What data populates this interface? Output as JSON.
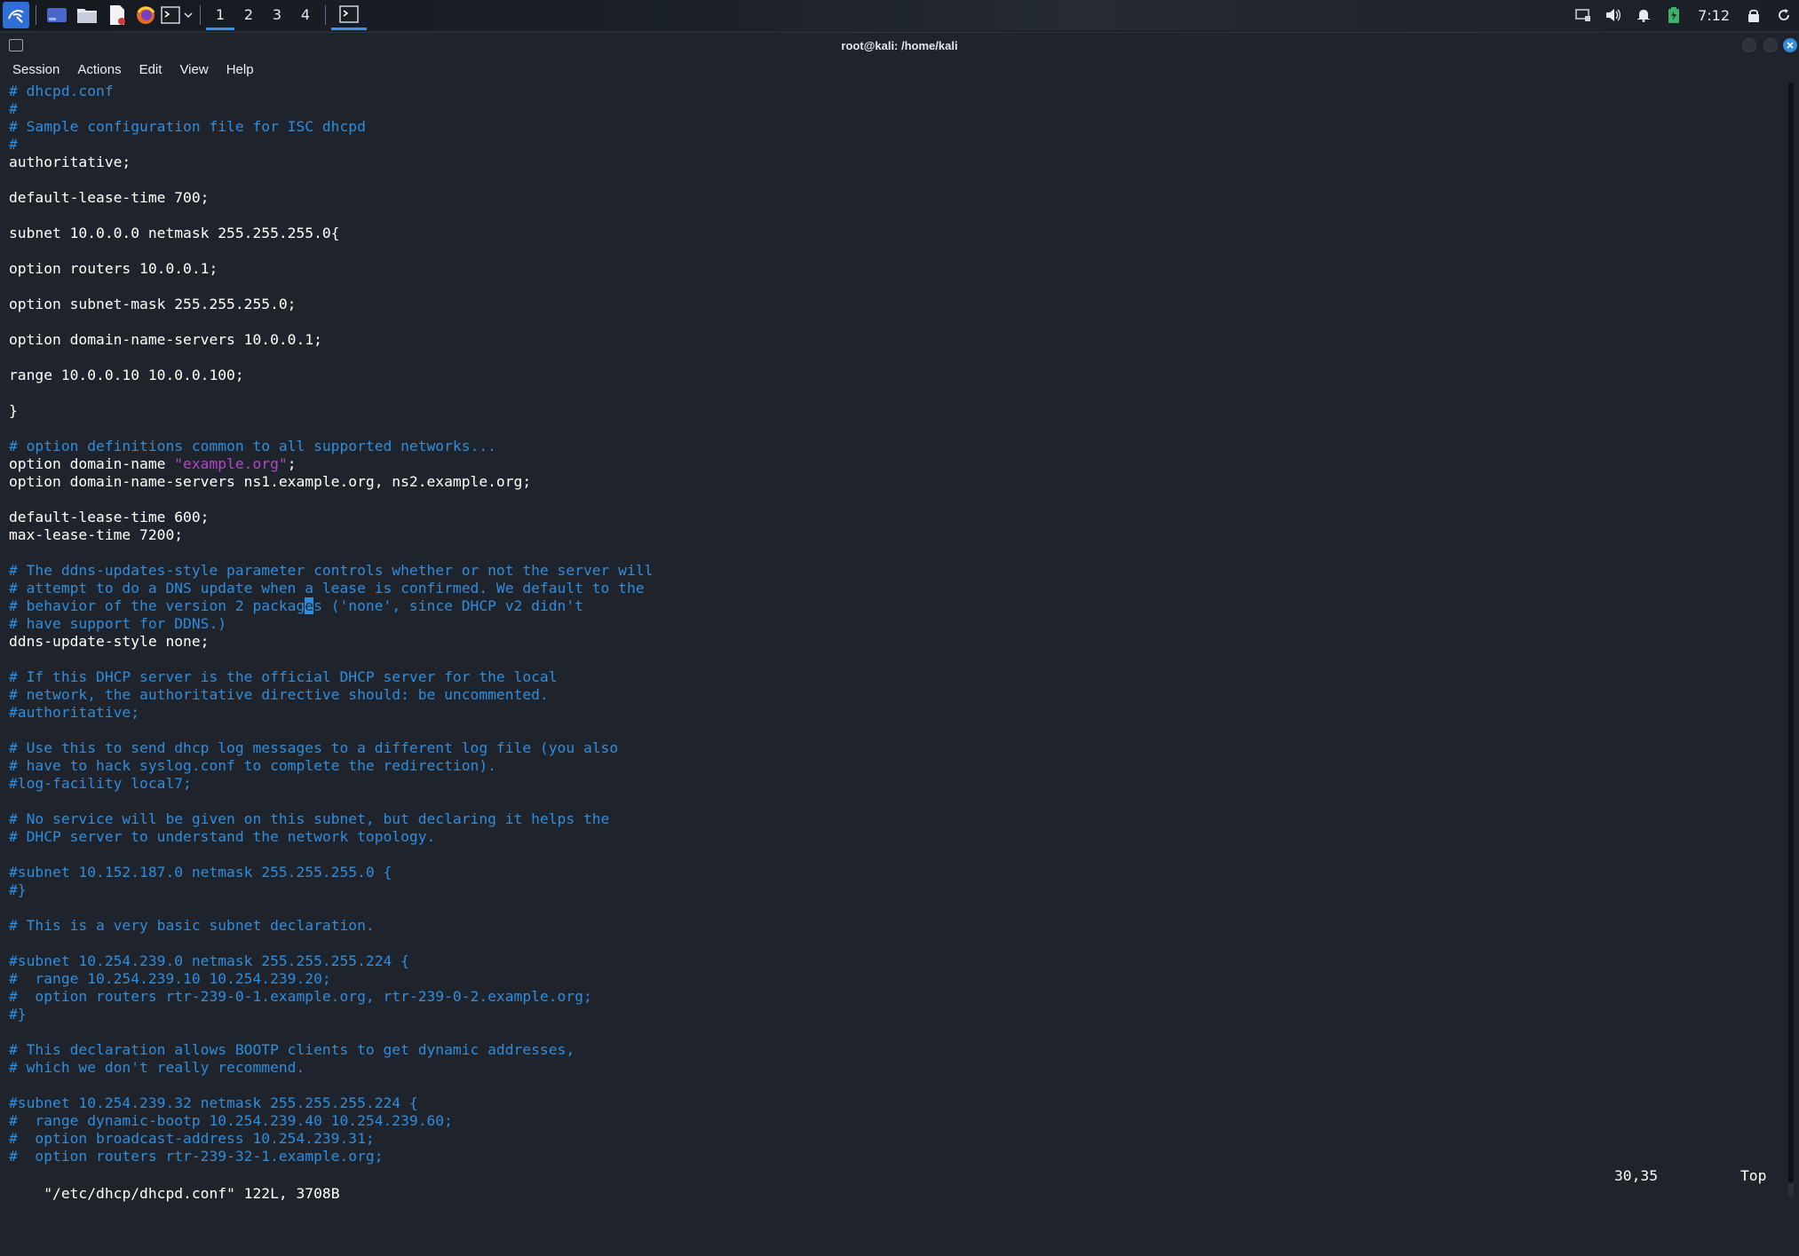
{
  "panel": {
    "workspaces": [
      "1",
      "2",
      "3",
      "4"
    ],
    "active_workspace": "1",
    "clock": "7:12",
    "icons": [
      "kali-menu-icon",
      "desktop-icon",
      "file-manager-icon",
      "text-editor-icon",
      "firefox-icon",
      "terminal-icon",
      "chevron-down-icon"
    ]
  },
  "window": {
    "title": "root@kali: /home/kali",
    "menu": [
      "Session",
      "Actions",
      "Edit",
      "View",
      "Help"
    ]
  },
  "editor": {
    "lines": [
      [
        {
          "t": "# dhcpd.conf",
          "k": "c"
        }
      ],
      [
        {
          "t": "#",
          "k": "c"
        }
      ],
      [
        {
          "t": "# Sample configuration file for ISC dhcpd",
          "k": "c"
        }
      ],
      [
        {
          "t": "#",
          "k": "c"
        }
      ],
      [
        {
          "t": "authoritative;",
          "k": "n"
        }
      ],
      [],
      [
        {
          "t": "default-lease-time 700;",
          "k": "n"
        }
      ],
      [],
      [
        {
          "t": "subnet 10.0.0.0 netmask 255.255.255.0{",
          "k": "n"
        }
      ],
      [],
      [
        {
          "t": "option routers 10.0.0.1;",
          "k": "n"
        }
      ],
      [],
      [
        {
          "t": "option subnet-mask 255.255.255.0;",
          "k": "n"
        }
      ],
      [],
      [
        {
          "t": "option domain-name-servers 10.0.0.1;",
          "k": "n"
        }
      ],
      [],
      [
        {
          "t": "range 10.0.0.10 10.0.0.100;",
          "k": "n"
        }
      ],
      [],
      [
        {
          "t": "}",
          "k": "n"
        }
      ],
      [],
      [
        {
          "t": "# option definitions common to all supported networks...",
          "k": "c"
        }
      ],
      [
        {
          "t": "option domain-name ",
          "k": "n"
        },
        {
          "t": "\"example.org\"",
          "k": "s"
        },
        {
          "t": ";",
          "k": "n"
        }
      ],
      [
        {
          "t": "option domain-name-servers ns1.example.org, ns2.example.org;",
          "k": "n"
        }
      ],
      [],
      [
        {
          "t": "default-lease-time 600;",
          "k": "n"
        }
      ],
      [
        {
          "t": "max-lease-time 7200;",
          "k": "n"
        }
      ],
      [],
      [
        {
          "t": "# The ddns-updates-style parameter controls whether or not the server will",
          "k": "c"
        }
      ],
      [
        {
          "t": "# attempt to do a DNS update when a lease is confirmed. We default to the",
          "k": "c"
        }
      ],
      [
        {
          "t": "# behavior of the version 2 packag",
          "k": "c"
        },
        {
          "t": "e",
          "k": "cursor"
        },
        {
          "t": "s ('none', since DHCP v2 didn't",
          "k": "c"
        }
      ],
      [
        {
          "t": "# have support for DDNS.)",
          "k": "c"
        }
      ],
      [
        {
          "t": "ddns-update-style none;",
          "k": "n"
        }
      ],
      [],
      [
        {
          "t": "# If this DHCP server is the official DHCP server for the local",
          "k": "c"
        }
      ],
      [
        {
          "t": "# network, the authoritative directive should: be uncommented.",
          "k": "c"
        }
      ],
      [
        {
          "t": "#authoritative;",
          "k": "c"
        }
      ],
      [],
      [
        {
          "t": "# Use this to send dhcp log messages to a different log file (you also",
          "k": "c"
        }
      ],
      [
        {
          "t": "# have to hack syslog.conf to complete the redirection).",
          "k": "c"
        }
      ],
      [
        {
          "t": "#log-facility local7;",
          "k": "c"
        }
      ],
      [],
      [
        {
          "t": "# No service will be given on this subnet, but declaring it helps the",
          "k": "c"
        }
      ],
      [
        {
          "t": "# DHCP server to understand the network topology.",
          "k": "c"
        }
      ],
      [],
      [
        {
          "t": "#subnet 10.152.187.0 netmask 255.255.255.0 {",
          "k": "c"
        }
      ],
      [
        {
          "t": "#}",
          "k": "c"
        }
      ],
      [],
      [
        {
          "t": "# This is a very basic subnet declaration.",
          "k": "c"
        }
      ],
      [],
      [
        {
          "t": "#subnet 10.254.239.0 netmask 255.255.255.224 {",
          "k": "c"
        }
      ],
      [
        {
          "t": "#  range 10.254.239.10 10.254.239.20;",
          "k": "c"
        }
      ],
      [
        {
          "t": "#  option routers rtr-239-0-1.example.org, rtr-239-0-2.example.org;",
          "k": "c"
        }
      ],
      [
        {
          "t": "#}",
          "k": "c"
        }
      ],
      [],
      [
        {
          "t": "# This declaration allows BOOTP clients to get dynamic addresses,",
          "k": "c"
        }
      ],
      [
        {
          "t": "# which we don't really recommend.",
          "k": "c"
        }
      ],
      [],
      [
        {
          "t": "#subnet 10.254.239.32 netmask 255.255.255.224 {",
          "k": "c"
        }
      ],
      [
        {
          "t": "#  range dynamic-bootp 10.254.239.40 10.254.239.60;",
          "k": "c"
        }
      ],
      [
        {
          "t": "#  option broadcast-address 10.254.239.31;",
          "k": "c"
        }
      ],
      [
        {
          "t": "#  option routers rtr-239-32-1.example.org;",
          "k": "c"
        }
      ]
    ],
    "colors": {
      "comment": "#2e8ddd",
      "normal": "#ffffff",
      "string": "#b347c8"
    }
  },
  "status": {
    "file": "\"/etc/dhcp/dhcpd.conf\" 122L, 3708B",
    "position": "30,35",
    "scroll": "Top"
  }
}
